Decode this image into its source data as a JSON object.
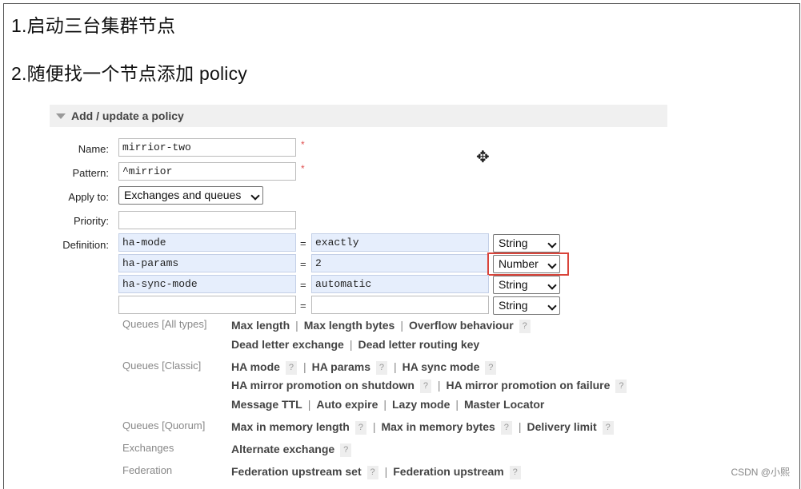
{
  "step1": "1.启动三台集群节点",
  "step2": "2.随便找一个节点添加 policy",
  "panel": {
    "title": "Add / update a policy"
  },
  "form": {
    "name_label": "Name:",
    "name_value": "mirrior-two",
    "pattern_label": "Pattern:",
    "pattern_value": "^mirrior",
    "required_mark": "*",
    "apply_label": "Apply to:",
    "apply_value": "Exchanges and queues",
    "priority_label": "Priority:",
    "priority_value": "",
    "definition_label": "Definition:",
    "eq": "=",
    "rows": [
      {
        "key": "ha-mode",
        "value": "exactly",
        "type": "String"
      },
      {
        "key": "ha-params",
        "value": "2",
        "type": "Number"
      },
      {
        "key": "ha-sync-mode",
        "value": "automatic",
        "type": "String"
      },
      {
        "key": "",
        "value": "",
        "type": "String"
      }
    ]
  },
  "help": {
    "q": "?",
    "cats": {
      "all": "Queues [All types]",
      "classic": "Queues [Classic]",
      "quorum": "Queues [Quorum]",
      "exchanges": "Exchanges",
      "federation": "Federation"
    },
    "links": {
      "max_length": "Max length",
      "max_length_bytes": "Max length bytes",
      "overflow": "Overflow behaviour",
      "dle": "Dead letter exchange",
      "dlrk": "Dead letter routing key",
      "ha_mode": "HA mode",
      "ha_params": "HA params",
      "ha_sync": "HA sync mode",
      "ha_shutdown": "HA mirror promotion on shutdown",
      "ha_failure": "HA mirror promotion on failure",
      "ttl": "Message TTL",
      "auto_expire": "Auto expire",
      "lazy": "Lazy mode",
      "locator": "Master Locator",
      "max_mem_len": "Max in memory length",
      "max_mem_bytes": "Max in memory bytes",
      "delivery_limit": "Delivery limit",
      "alt_exchange": "Alternate exchange",
      "fed_set": "Federation upstream set",
      "fed_upstream": "Federation upstream"
    },
    "sep": "|"
  },
  "watermark": "CSDN @小熙",
  "colors": {
    "highlight": "#d9443a",
    "field_blue": "#e6eefc",
    "required": "#e05050"
  }
}
